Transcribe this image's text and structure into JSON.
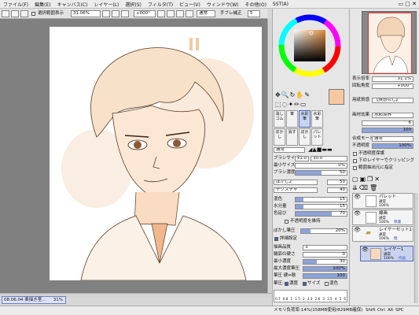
{
  "menu": {
    "items": [
      "ファイル(F)",
      "編集(E)",
      "キャンバス(C)",
      "レイヤー(L)",
      "選択(S)",
      "フィルタ(T)",
      "ビュー(V)",
      "ウィンドウ(W)",
      "その他(O)",
      "SST(A)"
    ]
  },
  "toolbar": {
    "selection_label": "選択範囲表示",
    "zoom": "31.06%",
    "angle": "+000°",
    "blend": "通常",
    "stabilizer_label": "手ブレ補正",
    "stabilizer_value": "5"
  },
  "navigator": {
    "zoom_label": "表示倍率",
    "zoom_value": "31.1%",
    "angle_label": "回転角度",
    "angle_value": "+000°"
  },
  "paper_texture": {
    "label": "用紙質感",
    "value": "【質感なし】"
  },
  "paper_effect": {
    "label": "画材効果",
    "value": "水彩境界",
    "width_value": "6",
    "strength_value": "100"
  },
  "layer_props": {
    "blend_label": "合成モード",
    "blend_value": "通常",
    "opacity_label": "不透明度",
    "opacity_value": "100%",
    "protect_label": "不透明度保護",
    "clip_label": "下のレイヤーでクリッピング",
    "select_src_label": "範囲抽出元に指定"
  },
  "tools": {
    "row1": [
      "消しゴム",
      "筆",
      "水彩筆",
      "水彩筆"
    ],
    "row2": [
      "ぼかし",
      "消す",
      "ぼかし",
      "パレット"
    ]
  },
  "brush": {
    "blend": "通常",
    "size_label": "ブラシサイズ",
    "size_mult": "x1.0",
    "size_value": "30.0",
    "min_size_label": "最小サイズ",
    "min_size_value": "0%",
    "density_label": "ブラシ濃度",
    "density_value": "50",
    "shape": "ぼかし2",
    "shape_value": "50",
    "texture": "テクスチャ",
    "texture_value": "40",
    "blending_label": "混色",
    "blending_value": "15",
    "dilution_label": "水分量",
    "dilution_value": "15",
    "persistence_label": "色延び",
    "persistence_value": "70",
    "keep_opacity_label": "不透明度を維持",
    "blur_label": "ぼかし筆圧",
    "blur_value": "20%",
    "detail_label": "詳細設定",
    "quality_label": "描画品質",
    "quality_value": "3",
    "edge_label": "輪郭の硬さ",
    "edge_value": "0",
    "min_density_label": "最小濃度",
    "min_density_value": "30",
    "max_density_label": "最大濃度筆圧",
    "max_density_value": "100%",
    "pressure_label": "筆圧 硬⇔軟",
    "pressure_value": "100",
    "pressure2_label": "筆圧:",
    "pr_density": "濃度",
    "pr_size": "サイズ",
    "pr_blend": "混色",
    "dot_sizes": [
      "0.7",
      "0.8",
      "1",
      "1.5",
      "2",
      "2.3",
      "2.6",
      "3",
      "3.5",
      "4",
      "5",
      "6"
    ]
  },
  "layers": [
    {
      "name": "パレット",
      "mode": "通常",
      "opacity": "100%",
      "tag": ""
    },
    {
      "name": "線画",
      "mode": "通常",
      "opacity": "100%",
      "tag": "保護"
    },
    {
      "name": "レイヤーセット1",
      "mode": "通常",
      "opacity": "100%",
      "tag": "閉"
    },
    {
      "name": "レイヤー1",
      "mode": "通常",
      "opacity": "100%",
      "tag": "作画"
    }
  ],
  "status": {
    "file": "08.06.04 楽描き室...",
    "file_zoom": "31%",
    "memory": "メモリ負荷率:14%(158MB使用/829MB確保)",
    "keys": [
      "Shift",
      "Ctrl",
      "Alt",
      "SPC"
    ]
  },
  "colors": {
    "accent": "#8da2d8",
    "current_color": "#f7c8a0",
    "skin": "#f1b88d"
  }
}
